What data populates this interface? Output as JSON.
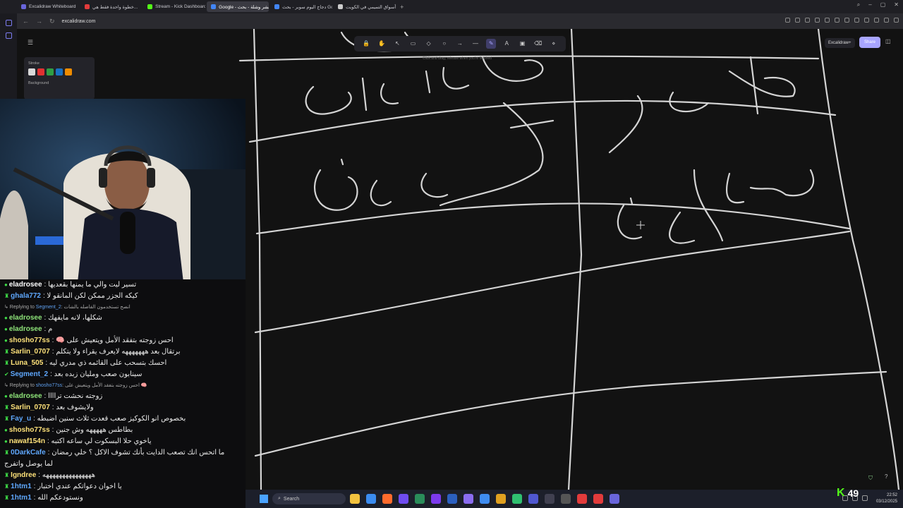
{
  "browser": {
    "tabs": [
      {
        "label": "Excalidraw Whiteboard",
        "active": false,
        "color": "#6965db"
      },
      {
        "label": "خطوة واحدة فقط هي...",
        "active": false,
        "color": "#e23b3b"
      },
      {
        "label": "Stream - Kick Dashboard",
        "active": false,
        "color": "#53fc18"
      },
      {
        "label": "Google - غشر وشلة - بحث",
        "active": true,
        "color": "#4285f4"
      },
      {
        "label": "دجاج اليوم سوبر - بحث Google",
        "active": false,
        "color": "#4285f4"
      },
      {
        "label": "أسواق التميمي في الكويت",
        "active": false,
        "color": "#cccccc"
      }
    ],
    "url": "excalidraw.com"
  },
  "excalidraw": {
    "tools": [
      {
        "name": "lock-icon",
        "glyph": "🔒",
        "active": false
      },
      {
        "name": "hand-icon",
        "glyph": "✋",
        "active": false
      },
      {
        "name": "select-icon",
        "glyph": "↖",
        "active": false
      },
      {
        "name": "rectangle-icon",
        "glyph": "▭",
        "active": false
      },
      {
        "name": "diamond-icon",
        "glyph": "◇",
        "active": false
      },
      {
        "name": "ellipse-icon",
        "glyph": "○",
        "active": false
      },
      {
        "name": "arrow-icon",
        "glyph": "→",
        "active": false
      },
      {
        "name": "line-icon",
        "glyph": "—",
        "active": false
      },
      {
        "name": "pencil-icon",
        "glyph": "✎",
        "active": true
      },
      {
        "name": "text-icon",
        "glyph": "A",
        "active": false
      },
      {
        "name": "image-icon",
        "glyph": "▣",
        "active": false
      },
      {
        "name": "eraser-icon",
        "glyph": "⌫",
        "active": false
      },
      {
        "name": "extra-tools-icon",
        "glyph": "⋄",
        "active": false
      }
    ],
    "hint": "Click and drag, release when you're finished",
    "stroke_label": "Stroke",
    "background_label": "Background",
    "stroke_colors": [
      "#d9d9d9",
      "#e03131",
      "#2f9e44",
      "#1971c2",
      "#f08c00"
    ],
    "library_label": "Excalidraw+",
    "share_label": "Share"
  },
  "chat": {
    "items": [
      {
        "kind": "msg",
        "user": "eladrosee",
        "color": "#ffffff",
        "badge": "●",
        "text": "تسير ليت والي ما يمنها بقعديها"
      },
      {
        "kind": "msg",
        "user": "ghala772",
        "color": "#5fa8ff",
        "badge": "♜",
        "text": "كيكه الجزر ممكن لكن المانقو لا"
      },
      {
        "kind": "reply",
        "reply_to": "Segment_2",
        "text": "انصح تستخدمون الفاصله بالشات"
      },
      {
        "kind": "msg",
        "user": "eladrosee",
        "color": "#8fe57a",
        "badge": "●",
        "text": "شكلها، لانه مايفهك"
      },
      {
        "kind": "msg",
        "user": "eladrosee",
        "color": "#8fe57a",
        "badge": "●",
        "text": "م"
      },
      {
        "kind": "msg",
        "user": "shosho77ss",
        "color": "#ffe27a",
        "badge": "●",
        "text": "احس زوجته بتفقد الأمل ويتعيش على 🧠"
      },
      {
        "kind": "msg",
        "user": "Sarlin_0707",
        "color": "#ffe27a",
        "badge": "♜",
        "text": "برتقال بعد هههههههه لايعرف يقراء ولا يتكلم"
      },
      {
        "kind": "msg",
        "user": "Luna_505",
        "color": "#ffe27a",
        "badge": "♜",
        "text": "احسك بتسحب على القائمه ذي مدري ليه"
      },
      {
        "kind": "msg",
        "user": "Segment_2",
        "color": "#5fa8ff",
        "badge": "✔",
        "text": "سينابون صعب ومليان زبده بعد"
      },
      {
        "kind": "reply",
        "reply_to": "shosho77ss",
        "text": "احس زوجته بتفقد الأمل ويتعيش على 🧠"
      },
      {
        "kind": "msg",
        "user": "eladrosee",
        "color": "#8fe57a",
        "badge": "●",
        "text": "زوجته نحشت تراااا"
      },
      {
        "kind": "msg",
        "user": "Sarlin_0707",
        "color": "#ffe27a",
        "badge": "♜",
        "text": "ولايشوف بعد"
      },
      {
        "kind": "msg",
        "user": "Fay_u",
        "color": "#5fa8ff",
        "badge": "♜",
        "text": "بخصوص انو الكوكيز صعب قعدت ثلاث سنين اضبطه"
      },
      {
        "kind": "msg",
        "user": "shosho77ss",
        "color": "#ffe27a",
        "badge": "●",
        "text": "بطاطس هههههه وش جنين"
      },
      {
        "kind": "msg",
        "user": "nawaf154n",
        "color": "#ffe27a",
        "badge": "●",
        "text": "ياخوي حلا البسكوت لي ساعه اكتبه"
      },
      {
        "kind": "msg",
        "user": "0DarkCafe",
        "color": "#5fa8ff",
        "badge": "♜",
        "text": "ما اتحس انك تصعب الدايت بأنك تشوف الاكل ؟ خلي رمضان"
      },
      {
        "kind": "cont",
        "text": "لما يوصل واتفرج"
      },
      {
        "kind": "msg",
        "user": "Igndree",
        "color": "#ffe27a",
        "badge": "♜",
        "text": "هههههههههههههههه"
      },
      {
        "kind": "msg",
        "user": "1htm1",
        "color": "#5fa8ff",
        "badge": "♜",
        "text": "يا اخوان دعواتكم عندي اختبار"
      },
      {
        "kind": "msg",
        "user": "1htm1",
        "color": "#5fa8ff",
        "badge": "♜",
        "text": "ونستودعكم الله"
      }
    ]
  },
  "taskbar": {
    "search_label": "Search",
    "time": "22:52",
    "date": "03/12/2025",
    "apps": [
      "#f3c33f",
      "#3b8cf0",
      "#ff6b2c",
      "#6f4cf0",
      "#2a8c5a",
      "#7c3aed",
      "#2b5fbf",
      "#8a6cf0",
      "#3f8cf0",
      "#e0a020",
      "#30c070",
      "#5058d0",
      "#404050",
      "#555",
      "#e23b3b",
      "#e23b3b",
      "#6965db"
    ]
  },
  "kick": {
    "viewer_count": "49"
  }
}
